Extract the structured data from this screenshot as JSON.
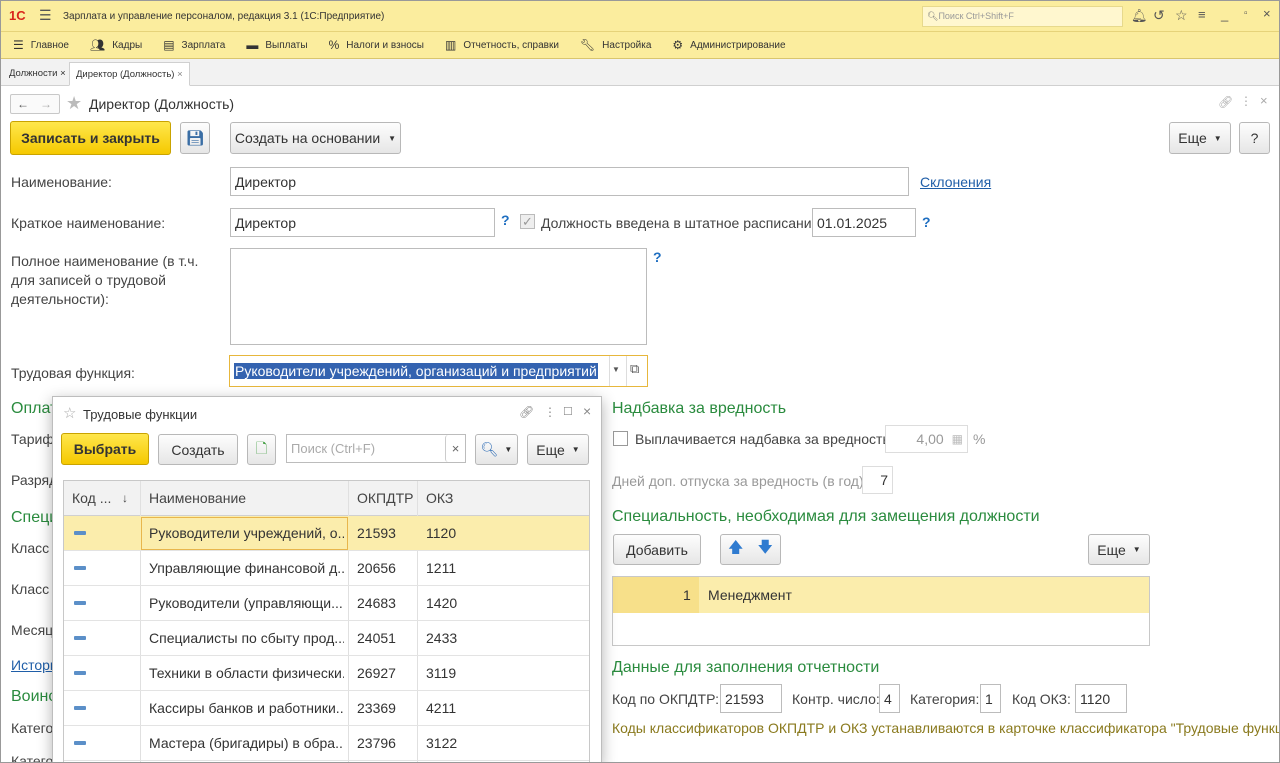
{
  "window": {
    "title": "Зарплата и управление персоналом, редакция 3.1  (1С:Предприятие)",
    "logo": "1С",
    "search_placeholder": "Поиск Ctrl+Shift+F"
  },
  "menu": [
    "Главное",
    "Кадры",
    "Зарплата",
    "Выплаты",
    "Налоги и взносы",
    "Отчетность, справки",
    "Настройка",
    "Администрирование"
  ],
  "tabs": [
    {
      "label": "Должности",
      "close": "×"
    },
    {
      "label": "Директор (Должность)",
      "close": "×"
    }
  ],
  "form": {
    "title": "Директор (Должность)",
    "save_close": "Записать и закрыть",
    "create_based": "Создать на основании",
    "more": "Еще",
    "help": "?",
    "name_label": "Наименование:",
    "name_value": "Директор",
    "declensions": "Склонения",
    "short_label": "Краткое наименование:",
    "short_value": "Директор",
    "q": "?",
    "in_schedule_label": "Должность введена в штатное расписание",
    "in_schedule_date": "01.01.2025",
    "full_label": "Полное наименование (в т.ч. для записей о трудовой деятельности):",
    "labor_func_label": "Трудовая функция:",
    "labor_func_value": "Руководители учреждений, организаций и предприятий",
    "hidden_left": [
      "Оплат",
      "Тариф",
      "Разряд",
      "Специ",
      "Класс у",
      "Класс у",
      "Месяц",
      "Истори",
      "Воинс",
      "Катего",
      "Катего"
    ]
  },
  "hazard": {
    "heading": "Надбавка за вредность",
    "check_label": "Выплачивается надбавка за вредность",
    "percent_value": "4,00",
    "percent_sign": "%",
    "days_label": "Дней доп. отпуска за вредность (в год):",
    "days_value": "7"
  },
  "specialty": {
    "heading": "Специальность, необходимая для замещения должности",
    "add": "Добавить",
    "more": "Еще",
    "rows": [
      {
        "n": "1",
        "name": "Менеджмент"
      }
    ]
  },
  "report": {
    "heading": "Данные для заполнения отчетности",
    "okpdtr_label": "Код по ОКПДТР:",
    "okpdtr_value": "21593",
    "control_label": "Контр. число:",
    "control_value": "4",
    "category_label": "Категория:",
    "category_value": "1",
    "okz_label": "Код ОКЗ:",
    "okz_value": "1120",
    "note": "Коды классификаторов ОКПДТР и ОКЗ устанавливаются в карточке классификатора \"Трудовые функции\"."
  },
  "popup": {
    "title": "Трудовые функции",
    "select": "Выбрать",
    "create": "Создать",
    "search_placeholder": "Поиск (Ctrl+F)",
    "clear": "×",
    "more": "Еще",
    "columns": [
      "Код ...",
      "Наименование",
      "ОКПДТР",
      "ОКЗ"
    ],
    "rows": [
      {
        "name": "Руководители учреждений, о...",
        "okpdtr": "21593",
        "okz": "1120"
      },
      {
        "name": "Управляющие финансовой д...",
        "okpdtr": "20656",
        "okz": "1211"
      },
      {
        "name": "Руководители (управляющи...",
        "okpdtr": "24683",
        "okz": "1420"
      },
      {
        "name": "Специалисты по сбыту прод...",
        "okpdtr": "24051",
        "okz": "2433"
      },
      {
        "name": "Техники в области физически...",
        "okpdtr": "26927",
        "okz": "3119"
      },
      {
        "name": "Кассиры банков и работники...",
        "okpdtr": "23369",
        "okz": "4211"
      },
      {
        "name": "Мастера (бригадиры) в обра...",
        "okpdtr": "23796",
        "okz": "3122"
      }
    ]
  }
}
